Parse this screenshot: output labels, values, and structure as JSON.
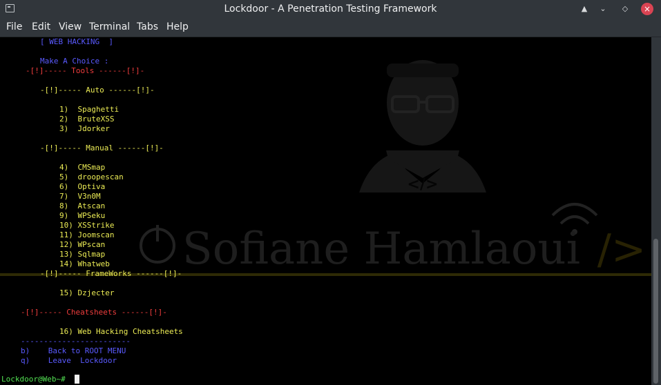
{
  "window": {
    "title": "Lockdoor - A Penetration Testing Framework",
    "controls": {
      "keep_above": "▲",
      "minimize": "⌄",
      "maximize": "◇",
      "close": "×"
    }
  },
  "menu": [
    "File",
    "Edit",
    "View",
    "Terminal",
    "Tabs",
    "Help"
  ],
  "terminal": {
    "section_header": "[ WEB HACKING  ]",
    "prompt_choice": "Make A Choice :",
    "tools_header": "-[!]----- Tools ------[!]-",
    "auto_header": "-[!]----- Auto ------[!]-",
    "auto_items": [
      "1)  Spaghetti",
      "2)  BruteXSS",
      "3)  Jdorker"
    ],
    "manual_header": "-[!]----- Manual ------[!]-",
    "manual_items": [
      "4)  CMSmap",
      "5)  droopescan",
      "6)  Optiva",
      "7)  V3n0M",
      "8)  Atscan",
      "9)  WPSeku",
      "10) XSStrike",
      "11) Joomscan",
      "12) WPscan",
      "13) Sqlmap",
      "14) Whatweb"
    ],
    "frameworks_header": "-[!]----- FrameWorks ------[!]-",
    "frameworks_items": [
      "15) Dzjecter"
    ],
    "cheatsheets_header": "-[!]----- Cheatsheets ------[!]-",
    "cheatsheets_items": [
      "16) Web Hacking Cheatsheets"
    ],
    "separator": "------------------------",
    "back_option": "b)    Back to ROOT MENU",
    "quit_option": "q)    Leave  Lockdoor",
    "shell_prompt": "Lockdoor@Web~# "
  },
  "watermark": {
    "name": "Sofiane Hamlaoui",
    "code_symbol": "</>"
  },
  "colors": {
    "titlebar": "#31363b",
    "terminal_bg": "#000000",
    "blue_text": "#5a5aff",
    "red_text": "#ef3d3d",
    "yellow_text": "#ecec55",
    "green_text": "#52e052",
    "close_button": "#da4453"
  }
}
